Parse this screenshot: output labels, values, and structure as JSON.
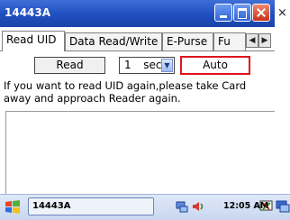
{
  "window": {
    "title": "14443A",
    "outer_close": "×"
  },
  "tabs": [
    {
      "label": "Read UID",
      "active": true
    },
    {
      "label": "Data Read/Write",
      "active": false
    },
    {
      "label": "E-Purse",
      "active": false
    },
    {
      "label": "Fu",
      "active": false
    }
  ],
  "tab_scroll": {
    "left": "◀",
    "right": "▶"
  },
  "panel": {
    "read_button": "Read",
    "interval_value": "1",
    "interval_unit": "sec",
    "auto_button": "Auto",
    "message": "If you want to read UID again,please take Card away and approach Reader again."
  },
  "taskbar": {
    "task_label": "14443A",
    "clock": "12:05 AM"
  },
  "colors": {
    "titlebar": "#1f4fbf",
    "highlight": "#e0141a",
    "taskbar": "#c8d7f0"
  },
  "icons": [
    "start-icon",
    "network-icon",
    "volume-icon",
    "sync-icon",
    "desktop-icon"
  ]
}
